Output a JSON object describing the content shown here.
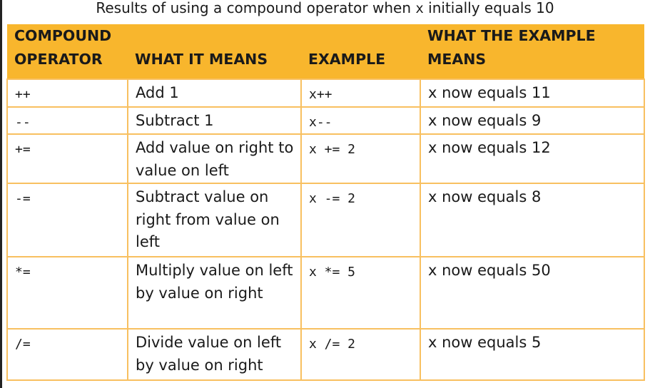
{
  "caption": {
    "before": "Results of using a compound operator when ",
    "var": "x",
    "after": " initially equals 10"
  },
  "table": {
    "headers": {
      "operator_line1": "COMPOUND",
      "operator_line2": "OPERATOR",
      "meaning": "WHAT IT MEANS",
      "example": "EXAMPLE",
      "result_line1": "WHAT THE EXAMPLE",
      "result_line2": "MEANS"
    },
    "rows": [
      {
        "operator": "++",
        "meaning": "Add 1",
        "example": "x++",
        "result": "x now equals 11"
      },
      {
        "operator": "--",
        "meaning": "Subtract 1",
        "example": "x--",
        "result": "x now equals 9"
      },
      {
        "operator": "+=",
        "meaning": "Add value on right to value on left",
        "example": "x += 2",
        "result": "x now equals 12"
      },
      {
        "operator": "-=",
        "meaning": "Subtract value on right from value on left",
        "example": "x -= 2",
        "result": "x now equals 8"
      },
      {
        "operator": "*=",
        "meaning": "Multiply value on left by value on right",
        "example": "x *= 5",
        "result": "x now equals 50"
      },
      {
        "operator": "/=",
        "meaning": "Divide value on left by value on right",
        "example": "x /= 2",
        "result": "x now equals 5"
      }
    ]
  },
  "colors": {
    "header_bg": "#f8b62d",
    "grid_line": "#f8c060"
  }
}
